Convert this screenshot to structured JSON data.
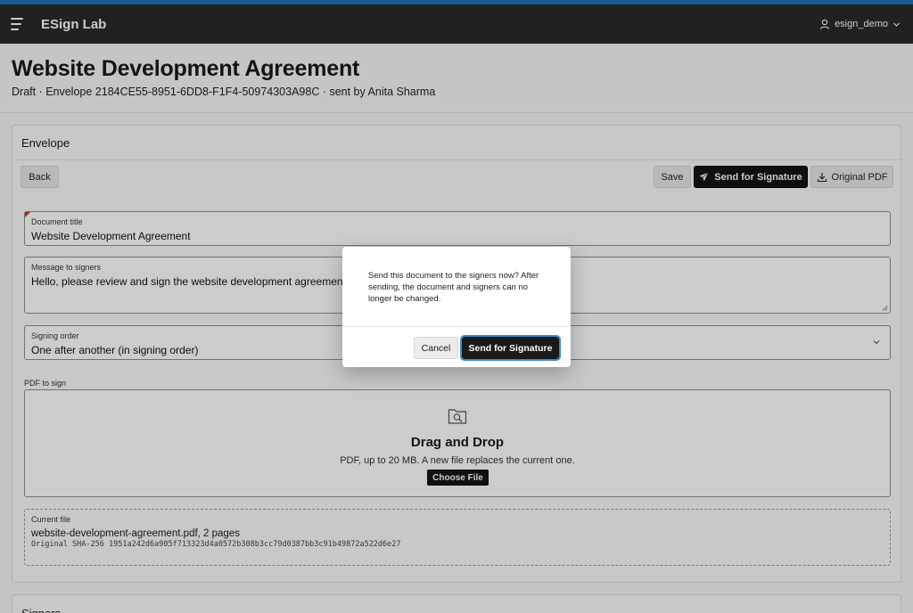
{
  "app": {
    "name": "ESign Lab",
    "user": "esign_demo"
  },
  "page": {
    "title": "Website Development Agreement",
    "subtitle": "Draft · Envelope 2184CE55-8951-6DD8-F1F4-50974303A98C · sent by Anita Sharma"
  },
  "envelope": {
    "header": "Envelope",
    "buttons": {
      "back": "Back",
      "save": "Save",
      "send": "Send for Signature",
      "original_pdf": "Original PDF"
    },
    "document_title": {
      "label": "Document title",
      "value": "Website Development Agreement"
    },
    "message": {
      "label": "Message to signers",
      "value": "Hello, please review and sign the website development agreement fo"
    },
    "signing_order": {
      "label": "Signing order",
      "value": "One after another (in signing order)"
    },
    "pdf": {
      "label": "PDF to sign",
      "drop_title": "Drag and Drop",
      "drop_hint": "PDF, up to 20 MB. A new file replaces the current one.",
      "choose_file": "Choose File"
    },
    "current_file": {
      "label": "Current file",
      "name": "website-development-agreement.pdf, 2 pages",
      "hash": "Original SHA-256 1951a242d6a905f713323d4a0572b308b3cc79d0387bb3c91b49872a522d6e27"
    }
  },
  "signers": {
    "header": "Signers"
  },
  "dialog": {
    "message": "Send this document to the signers now? After sending, the document and signers can no longer be changed.",
    "cancel": "Cancel",
    "confirm": "Send for Signature"
  },
  "colors": {
    "accent": "#1f6fb8",
    "navbar": "#2c2a28",
    "primary_button": "#131313",
    "required_marker": "#c0392b"
  },
  "icons": [
    "menu-icon",
    "user-icon",
    "chevron-down-icon",
    "send-icon",
    "download-icon",
    "file-search-icon",
    "resize-grip-icon"
  ]
}
